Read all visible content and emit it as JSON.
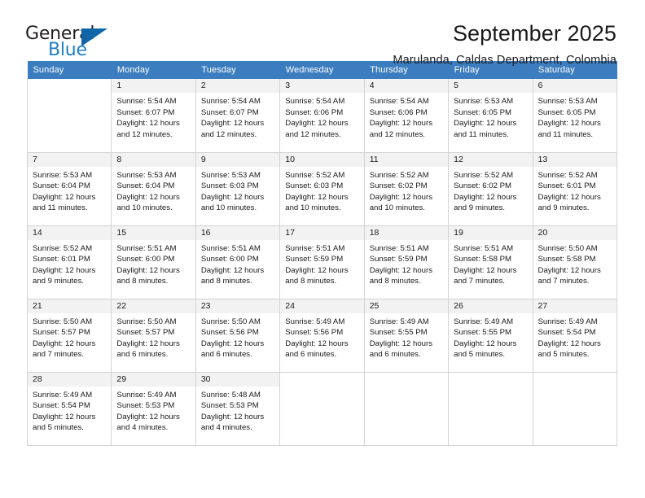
{
  "brand": {
    "name_top": "General",
    "name_bottom": "Blue",
    "triangle_color": "#1064a8",
    "blue_color": "#1f7fc4"
  },
  "header": {
    "title": "September 2025",
    "subtitle": "Marulanda, Caldas Department, Colombia"
  },
  "calendar": {
    "header_bg": "#3b7dbf",
    "daynum_bg": "#f2f2f2",
    "weekdays": [
      "Sunday",
      "Monday",
      "Tuesday",
      "Wednesday",
      "Thursday",
      "Friday",
      "Saturday"
    ],
    "weeks": [
      [
        {
          "day": "",
          "empty": true
        },
        {
          "day": "1",
          "sunrise": "Sunrise: 5:54 AM",
          "sunset": "Sunset: 6:07 PM",
          "daylight": "Daylight: 12 hours and 12 minutes."
        },
        {
          "day": "2",
          "sunrise": "Sunrise: 5:54 AM",
          "sunset": "Sunset: 6:07 PM",
          "daylight": "Daylight: 12 hours and 12 minutes."
        },
        {
          "day": "3",
          "sunrise": "Sunrise: 5:54 AM",
          "sunset": "Sunset: 6:06 PM",
          "daylight": "Daylight: 12 hours and 12 minutes."
        },
        {
          "day": "4",
          "sunrise": "Sunrise: 5:54 AM",
          "sunset": "Sunset: 6:06 PM",
          "daylight": "Daylight: 12 hours and 12 minutes."
        },
        {
          "day": "5",
          "sunrise": "Sunrise: 5:53 AM",
          "sunset": "Sunset: 6:05 PM",
          "daylight": "Daylight: 12 hours and 11 minutes."
        },
        {
          "day": "6",
          "sunrise": "Sunrise: 5:53 AM",
          "sunset": "Sunset: 6:05 PM",
          "daylight": "Daylight: 12 hours and 11 minutes."
        }
      ],
      [
        {
          "day": "7",
          "sunrise": "Sunrise: 5:53 AM",
          "sunset": "Sunset: 6:04 PM",
          "daylight": "Daylight: 12 hours and 11 minutes."
        },
        {
          "day": "8",
          "sunrise": "Sunrise: 5:53 AM",
          "sunset": "Sunset: 6:04 PM",
          "daylight": "Daylight: 12 hours and 10 minutes."
        },
        {
          "day": "9",
          "sunrise": "Sunrise: 5:53 AM",
          "sunset": "Sunset: 6:03 PM",
          "daylight": "Daylight: 12 hours and 10 minutes."
        },
        {
          "day": "10",
          "sunrise": "Sunrise: 5:52 AM",
          "sunset": "Sunset: 6:03 PM",
          "daylight": "Daylight: 12 hours and 10 minutes."
        },
        {
          "day": "11",
          "sunrise": "Sunrise: 5:52 AM",
          "sunset": "Sunset: 6:02 PM",
          "daylight": "Daylight: 12 hours and 10 minutes."
        },
        {
          "day": "12",
          "sunrise": "Sunrise: 5:52 AM",
          "sunset": "Sunset: 6:02 PM",
          "daylight": "Daylight: 12 hours and 9 minutes."
        },
        {
          "day": "13",
          "sunrise": "Sunrise: 5:52 AM",
          "sunset": "Sunset: 6:01 PM",
          "daylight": "Daylight: 12 hours and 9 minutes."
        }
      ],
      [
        {
          "day": "14",
          "sunrise": "Sunrise: 5:52 AM",
          "sunset": "Sunset: 6:01 PM",
          "daylight": "Daylight: 12 hours and 9 minutes."
        },
        {
          "day": "15",
          "sunrise": "Sunrise: 5:51 AM",
          "sunset": "Sunset: 6:00 PM",
          "daylight": "Daylight: 12 hours and 8 minutes."
        },
        {
          "day": "16",
          "sunrise": "Sunrise: 5:51 AM",
          "sunset": "Sunset: 6:00 PM",
          "daylight": "Daylight: 12 hours and 8 minutes."
        },
        {
          "day": "17",
          "sunrise": "Sunrise: 5:51 AM",
          "sunset": "Sunset: 5:59 PM",
          "daylight": "Daylight: 12 hours and 8 minutes."
        },
        {
          "day": "18",
          "sunrise": "Sunrise: 5:51 AM",
          "sunset": "Sunset: 5:59 PM",
          "daylight": "Daylight: 12 hours and 8 minutes."
        },
        {
          "day": "19",
          "sunrise": "Sunrise: 5:51 AM",
          "sunset": "Sunset: 5:58 PM",
          "daylight": "Daylight: 12 hours and 7 minutes."
        },
        {
          "day": "20",
          "sunrise": "Sunrise: 5:50 AM",
          "sunset": "Sunset: 5:58 PM",
          "daylight": "Daylight: 12 hours and 7 minutes."
        }
      ],
      [
        {
          "day": "21",
          "sunrise": "Sunrise: 5:50 AM",
          "sunset": "Sunset: 5:57 PM",
          "daylight": "Daylight: 12 hours and 7 minutes."
        },
        {
          "day": "22",
          "sunrise": "Sunrise: 5:50 AM",
          "sunset": "Sunset: 5:57 PM",
          "daylight": "Daylight: 12 hours and 6 minutes."
        },
        {
          "day": "23",
          "sunrise": "Sunrise: 5:50 AM",
          "sunset": "Sunset: 5:56 PM",
          "daylight": "Daylight: 12 hours and 6 minutes."
        },
        {
          "day": "24",
          "sunrise": "Sunrise: 5:49 AM",
          "sunset": "Sunset: 5:56 PM",
          "daylight": "Daylight: 12 hours and 6 minutes."
        },
        {
          "day": "25",
          "sunrise": "Sunrise: 5:49 AM",
          "sunset": "Sunset: 5:55 PM",
          "daylight": "Daylight: 12 hours and 6 minutes."
        },
        {
          "day": "26",
          "sunrise": "Sunrise: 5:49 AM",
          "sunset": "Sunset: 5:55 PM",
          "daylight": "Daylight: 12 hours and 5 minutes."
        },
        {
          "day": "27",
          "sunrise": "Sunrise: 5:49 AM",
          "sunset": "Sunset: 5:54 PM",
          "daylight": "Daylight: 12 hours and 5 minutes."
        }
      ],
      [
        {
          "day": "28",
          "sunrise": "Sunrise: 5:49 AM",
          "sunset": "Sunset: 5:54 PM",
          "daylight": "Daylight: 12 hours and 5 minutes."
        },
        {
          "day": "29",
          "sunrise": "Sunrise: 5:49 AM",
          "sunset": "Sunset: 5:53 PM",
          "daylight": "Daylight: 12 hours and 4 minutes."
        },
        {
          "day": "30",
          "sunrise": "Sunrise: 5:48 AM",
          "sunset": "Sunset: 5:53 PM",
          "daylight": "Daylight: 12 hours and 4 minutes."
        },
        {
          "day": "",
          "empty": true
        },
        {
          "day": "",
          "empty": true
        },
        {
          "day": "",
          "empty": true
        },
        {
          "day": "",
          "empty": true
        }
      ]
    ]
  }
}
